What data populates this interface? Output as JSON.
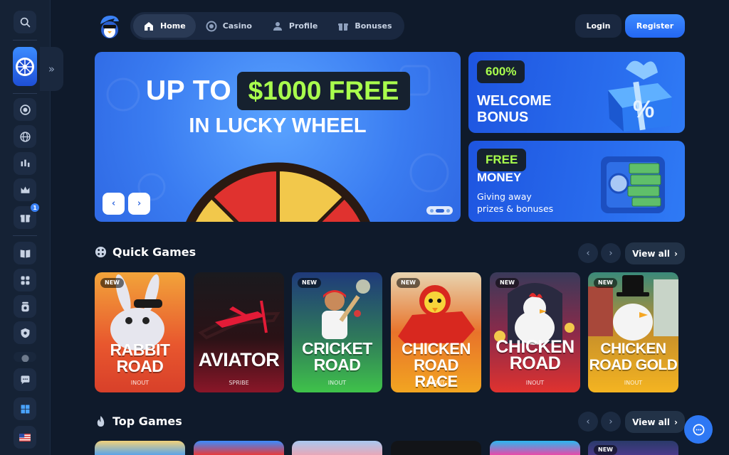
{
  "nav": {
    "items": [
      {
        "label": "Home",
        "icon": "home-icon",
        "active": true
      },
      {
        "label": "Casino",
        "icon": "chip-icon",
        "active": false
      },
      {
        "label": "Profile",
        "icon": "user-icon",
        "active": false
      },
      {
        "label": "Bonuses",
        "icon": "gift-icon",
        "active": false
      }
    ],
    "login": "Login",
    "register": "Register"
  },
  "sidebar": {
    "expand_glyph": "»",
    "gift_badge": "1"
  },
  "hero": {
    "line1": "UP TO",
    "highlight": "$1000 FREE",
    "line2": "IN LUCKY WHEEL",
    "prev": "‹",
    "next": "›"
  },
  "promos": [
    {
      "tag": "600%",
      "title_1": "WELCOME",
      "title_2": "BONUS"
    },
    {
      "tag": "FREE",
      "title": "MONEY",
      "sub_1": "Giving away",
      "sub_2": "prizes & bonuses"
    }
  ],
  "quick_games": {
    "title": "Quick Games",
    "view_all": "View all",
    "games": [
      {
        "title_1": "RABBIT",
        "title_2": "ROAD",
        "provider": "INOUT",
        "new": "NEW"
      },
      {
        "title_1": "AVIATOR",
        "title_2": "",
        "provider": "SPRIBE",
        "new": ""
      },
      {
        "title_1": "CRICKET",
        "title_2": "ROAD",
        "provider": "INOUT",
        "new": "NEW"
      },
      {
        "title_1": "CHICKEN",
        "title_2": "ROAD RACE",
        "provider": "INOUT",
        "new": "NEW"
      },
      {
        "title_1": "CHICKEN",
        "title_2": "ROAD",
        "provider": "INOUT",
        "new": "NEW"
      },
      {
        "title_1": "CHICKEN",
        "title_2": "ROAD GOLD",
        "provider": "INOUT",
        "new": "NEW"
      }
    ]
  },
  "top_games": {
    "title": "Top Games",
    "view_all": "View all",
    "new_badge": "NEW"
  },
  "colors": {
    "bg": "#0f1a2b",
    "accent": "#2e78f4",
    "lime": "#a9ff4d"
  }
}
